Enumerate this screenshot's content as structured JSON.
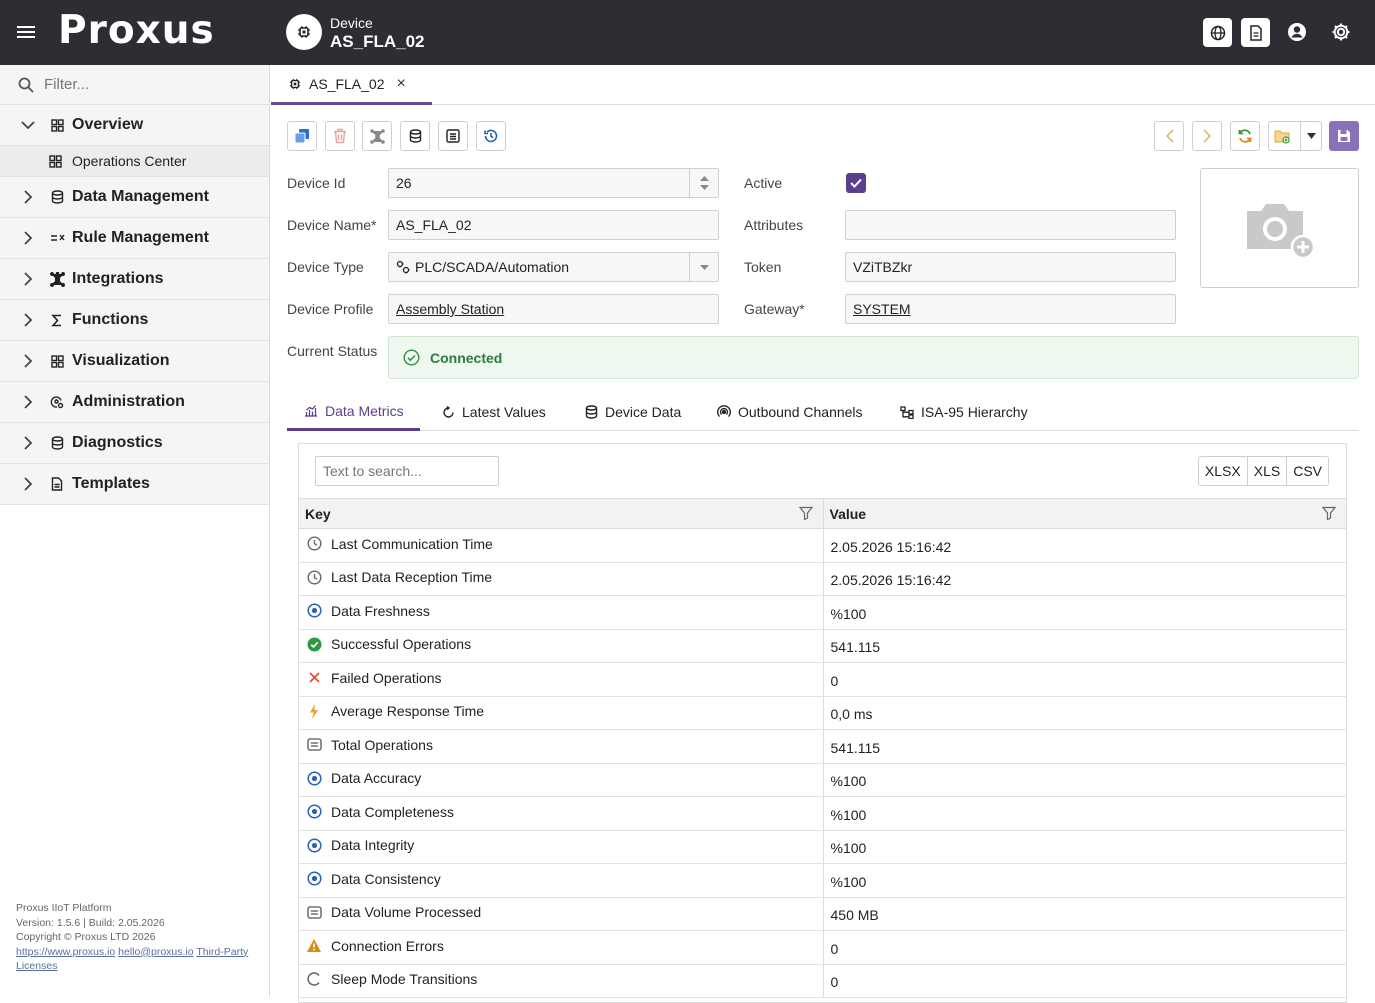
{
  "header": {
    "logo": "Proxus",
    "device_kind": "Device",
    "device_name": "AS_FLA_02"
  },
  "sidebar": {
    "filter_placeholder": "Filter...",
    "items": [
      {
        "label": "Overview",
        "icon": "grid-icon",
        "expanded": true
      },
      {
        "label": "Data Management",
        "icon": "database-icon"
      },
      {
        "label": "Rule Management",
        "icon": "rules-icon"
      },
      {
        "label": "Integrations",
        "icon": "network-icon"
      },
      {
        "label": "Functions",
        "icon": "sigma-icon"
      },
      {
        "label": "Visualization",
        "icon": "grid-icon"
      },
      {
        "label": "Administration",
        "icon": "admin-icon"
      },
      {
        "label": "Diagnostics",
        "icon": "database-icon"
      },
      {
        "label": "Templates",
        "icon": "document-icon"
      }
    ],
    "sub_items": [
      {
        "label": "Operations Center",
        "icon": "grid-icon"
      }
    ],
    "footer": {
      "line1": "Proxus IIoT Platform",
      "line2": "Version: 1.5.6 | Build: 2.05.2026",
      "line3": "Copyright © Proxus LTD 2026",
      "link_site": "https://www.proxus.io",
      "link_mail": "hello@proxus.io",
      "link_licenses": "Third-Party Licenses"
    }
  },
  "doc_tab": {
    "label": "AS_FLA_02",
    "close": "×"
  },
  "form": {
    "device_id_label": "Device Id",
    "device_id": "26",
    "device_name_label": "Device Name*",
    "device_name": "AS_FLA_02",
    "device_type_label": "Device Type",
    "device_type": "PLC/SCADA/Automation",
    "device_profile_label": "Device Profile",
    "device_profile": "Assembly Station",
    "active_label": "Active",
    "active": true,
    "attributes_label": "Attributes",
    "attributes": "",
    "token_label": "Token",
    "token": "VZiTBZkr",
    "gateway_label": "Gateway*",
    "gateway": "SYSTEM",
    "current_status_label": "Current Status",
    "current_status": "Connected"
  },
  "subtabs": [
    {
      "label": "Data Metrics",
      "icon": "chart-icon",
      "active": true
    },
    {
      "label": "Latest Values",
      "icon": "refresh-icon"
    },
    {
      "label": "Device Data",
      "icon": "database-icon"
    },
    {
      "label": "Outbound Channels",
      "icon": "broadcast-icon"
    },
    {
      "label": "ISA-95 Hierarchy",
      "icon": "hierarchy-icon"
    }
  ],
  "grid": {
    "search_placeholder": "Text to search...",
    "export": [
      "XLSX",
      "XLS",
      "CSV"
    ],
    "columns": [
      "Key",
      "Value"
    ],
    "rows": [
      {
        "key": "Last Communication Time",
        "value": "2.05.2026 15:16:42",
        "icon": "clock-icon"
      },
      {
        "key": "Last Data Reception Time",
        "value": "2.05.2026 15:16:42",
        "icon": "clock-icon"
      },
      {
        "key": "Data Freshness",
        "value": "%100",
        "icon": "target-icon"
      },
      {
        "key": "Successful Operations",
        "value": "541.115",
        "icon": "check-circle-icon"
      },
      {
        "key": "Failed Operations",
        "value": "0",
        "icon": "x-icon"
      },
      {
        "key": "Average Response Time",
        "value": "0,0 ms",
        "icon": "bolt-icon"
      },
      {
        "key": "Total Operations",
        "value": "541.115",
        "icon": "list-box-icon"
      },
      {
        "key": "Data Accuracy",
        "value": "%100",
        "icon": "target-icon"
      },
      {
        "key": "Data Completeness",
        "value": "%100",
        "icon": "target-icon"
      },
      {
        "key": "Data Integrity",
        "value": "%100",
        "icon": "target-icon"
      },
      {
        "key": "Data Consistency",
        "value": "%100",
        "icon": "target-icon"
      },
      {
        "key": "Data Volume Processed",
        "value": "450 MB",
        "icon": "list-box-icon"
      },
      {
        "key": "Connection Errors",
        "value": "0",
        "icon": "warning-icon"
      },
      {
        "key": "Sleep Mode Transitions",
        "value": "0",
        "icon": "spinner-icon"
      }
    ]
  },
  "colors": {
    "header_bg": "#2c2e33",
    "accent": "#5b3f8c",
    "success": "#2f7a3a",
    "status_bg": "#eef8ee"
  }
}
